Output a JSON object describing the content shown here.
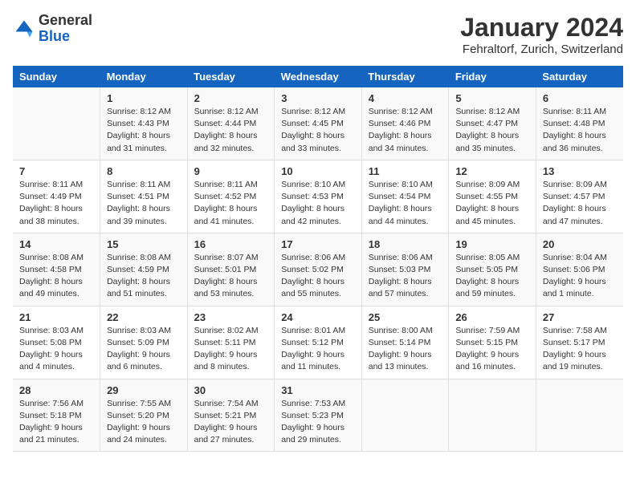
{
  "header": {
    "logo": {
      "general": "General",
      "blue": "Blue"
    },
    "title": "January 2024",
    "location": "Fehraltorf, Zurich, Switzerland"
  },
  "weekdays": [
    "Sunday",
    "Monday",
    "Tuesday",
    "Wednesday",
    "Thursday",
    "Friday",
    "Saturday"
  ],
  "weeks": [
    [
      {
        "day": "",
        "info": ""
      },
      {
        "day": "1",
        "info": "Sunrise: 8:12 AM\nSunset: 4:43 PM\nDaylight: 8 hours\nand 31 minutes."
      },
      {
        "day": "2",
        "info": "Sunrise: 8:12 AM\nSunset: 4:44 PM\nDaylight: 8 hours\nand 32 minutes."
      },
      {
        "day": "3",
        "info": "Sunrise: 8:12 AM\nSunset: 4:45 PM\nDaylight: 8 hours\nand 33 minutes."
      },
      {
        "day": "4",
        "info": "Sunrise: 8:12 AM\nSunset: 4:46 PM\nDaylight: 8 hours\nand 34 minutes."
      },
      {
        "day": "5",
        "info": "Sunrise: 8:12 AM\nSunset: 4:47 PM\nDaylight: 8 hours\nand 35 minutes."
      },
      {
        "day": "6",
        "info": "Sunrise: 8:11 AM\nSunset: 4:48 PM\nDaylight: 8 hours\nand 36 minutes."
      }
    ],
    [
      {
        "day": "7",
        "info": "Sunrise: 8:11 AM\nSunset: 4:49 PM\nDaylight: 8 hours\nand 38 minutes."
      },
      {
        "day": "8",
        "info": "Sunrise: 8:11 AM\nSunset: 4:51 PM\nDaylight: 8 hours\nand 39 minutes."
      },
      {
        "day": "9",
        "info": "Sunrise: 8:11 AM\nSunset: 4:52 PM\nDaylight: 8 hours\nand 41 minutes."
      },
      {
        "day": "10",
        "info": "Sunrise: 8:10 AM\nSunset: 4:53 PM\nDaylight: 8 hours\nand 42 minutes."
      },
      {
        "day": "11",
        "info": "Sunrise: 8:10 AM\nSunset: 4:54 PM\nDaylight: 8 hours\nand 44 minutes."
      },
      {
        "day": "12",
        "info": "Sunrise: 8:09 AM\nSunset: 4:55 PM\nDaylight: 8 hours\nand 45 minutes."
      },
      {
        "day": "13",
        "info": "Sunrise: 8:09 AM\nSunset: 4:57 PM\nDaylight: 8 hours\nand 47 minutes."
      }
    ],
    [
      {
        "day": "14",
        "info": "Sunrise: 8:08 AM\nSunset: 4:58 PM\nDaylight: 8 hours\nand 49 minutes."
      },
      {
        "day": "15",
        "info": "Sunrise: 8:08 AM\nSunset: 4:59 PM\nDaylight: 8 hours\nand 51 minutes."
      },
      {
        "day": "16",
        "info": "Sunrise: 8:07 AM\nSunset: 5:01 PM\nDaylight: 8 hours\nand 53 minutes."
      },
      {
        "day": "17",
        "info": "Sunrise: 8:06 AM\nSunset: 5:02 PM\nDaylight: 8 hours\nand 55 minutes."
      },
      {
        "day": "18",
        "info": "Sunrise: 8:06 AM\nSunset: 5:03 PM\nDaylight: 8 hours\nand 57 minutes."
      },
      {
        "day": "19",
        "info": "Sunrise: 8:05 AM\nSunset: 5:05 PM\nDaylight: 8 hours\nand 59 minutes."
      },
      {
        "day": "20",
        "info": "Sunrise: 8:04 AM\nSunset: 5:06 PM\nDaylight: 9 hours\nand 1 minute."
      }
    ],
    [
      {
        "day": "21",
        "info": "Sunrise: 8:03 AM\nSunset: 5:08 PM\nDaylight: 9 hours\nand 4 minutes."
      },
      {
        "day": "22",
        "info": "Sunrise: 8:03 AM\nSunset: 5:09 PM\nDaylight: 9 hours\nand 6 minutes."
      },
      {
        "day": "23",
        "info": "Sunrise: 8:02 AM\nSunset: 5:11 PM\nDaylight: 9 hours\nand 8 minutes."
      },
      {
        "day": "24",
        "info": "Sunrise: 8:01 AM\nSunset: 5:12 PM\nDaylight: 9 hours\nand 11 minutes."
      },
      {
        "day": "25",
        "info": "Sunrise: 8:00 AM\nSunset: 5:14 PM\nDaylight: 9 hours\nand 13 minutes."
      },
      {
        "day": "26",
        "info": "Sunrise: 7:59 AM\nSunset: 5:15 PM\nDaylight: 9 hours\nand 16 minutes."
      },
      {
        "day": "27",
        "info": "Sunrise: 7:58 AM\nSunset: 5:17 PM\nDaylight: 9 hours\nand 19 minutes."
      }
    ],
    [
      {
        "day": "28",
        "info": "Sunrise: 7:56 AM\nSunset: 5:18 PM\nDaylight: 9 hours\nand 21 minutes."
      },
      {
        "day": "29",
        "info": "Sunrise: 7:55 AM\nSunset: 5:20 PM\nDaylight: 9 hours\nand 24 minutes."
      },
      {
        "day": "30",
        "info": "Sunrise: 7:54 AM\nSunset: 5:21 PM\nDaylight: 9 hours\nand 27 minutes."
      },
      {
        "day": "31",
        "info": "Sunrise: 7:53 AM\nSunset: 5:23 PM\nDaylight: 9 hours\nand 29 minutes."
      },
      {
        "day": "",
        "info": ""
      },
      {
        "day": "",
        "info": ""
      },
      {
        "day": "",
        "info": ""
      }
    ]
  ]
}
